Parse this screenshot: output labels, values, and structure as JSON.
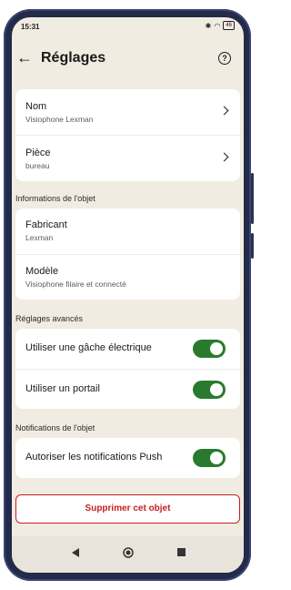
{
  "status": {
    "time": "15:31",
    "battery": "46"
  },
  "header": {
    "title": "Réglages"
  },
  "general": {
    "name": {
      "label": "Nom",
      "value": "Visiophone Lexman"
    },
    "room": {
      "label": "Pièce",
      "value": "bureau"
    }
  },
  "info": {
    "section_title": "Informations de l'objet",
    "manufacturer": {
      "label": "Fabricant",
      "value": "Lexman"
    },
    "model": {
      "label": "Modèle",
      "value": "Visiophone filaire et connecté"
    }
  },
  "advanced": {
    "section_title": "Réglages avancés",
    "electric_strike": {
      "label": "Utiliser une gâche électrique",
      "enabled": true
    },
    "gate": {
      "label": "Utiliser un portail",
      "enabled": true
    }
  },
  "notifications": {
    "section_title": "Notifications de l'objet",
    "push": {
      "label": "Autoriser les notifications Push",
      "enabled": true
    }
  },
  "actions": {
    "delete_label": "Supprimer cet objet"
  },
  "colors": {
    "accent_green": "#2a7a2e",
    "danger_red": "#c81e1e",
    "background": "#f1ece2"
  },
  "icons": {
    "back": "arrow-left-icon",
    "help": "help-circle-icon",
    "chevron": "chevron-right-icon"
  }
}
